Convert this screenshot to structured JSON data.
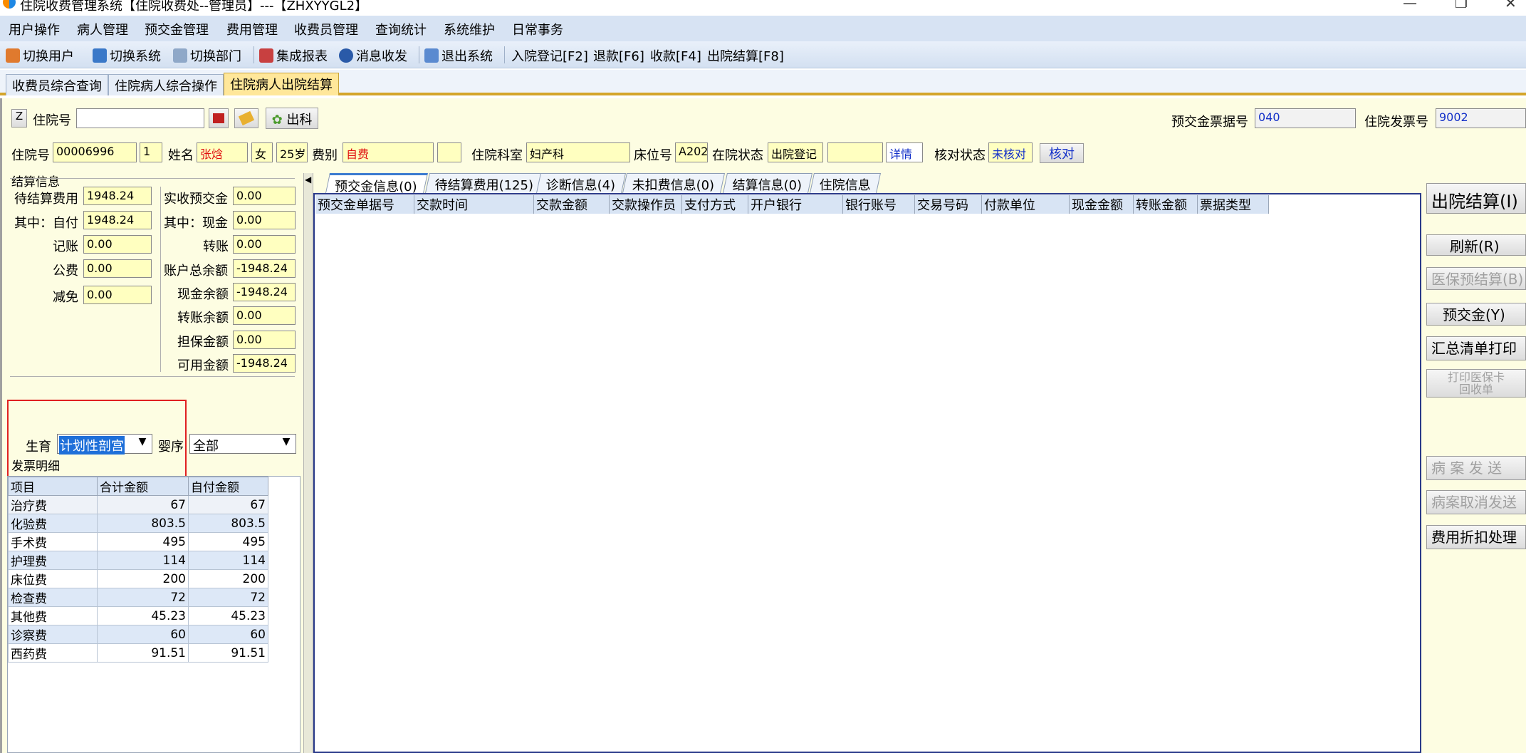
{
  "window": {
    "title": "住院收费管理系统【住院收费处--管理员】---【ZHXYYGL2】",
    "minimize": "—",
    "restore": "❐",
    "close": "✕"
  },
  "menu": [
    "用户操作",
    "病人管理",
    "预交金管理",
    "费用管理",
    "收费员管理",
    "查询统计",
    "系统维护",
    "日常事务"
  ],
  "toolbar": {
    "switch_user": "切换用户",
    "switch_system": "切换系统",
    "switch_dept": "切换部门",
    "report": "集成报表",
    "message": "消息收发",
    "exit": "退出系统",
    "admit": "入院登记[F2]",
    "refund": "退款[F6]",
    "charge": "收款[F4]",
    "discharge": "出院结算[F8]"
  },
  "tabs": [
    "收费员综合查询",
    "住院病人综合操作",
    "住院病人出院结算"
  ],
  "search": {
    "z_label": "Z",
    "inpatient_no_label": "住院号",
    "inpatient_no_value": "",
    "discharge_btn": "出科",
    "deposit_receipt_label": "预交金票据号",
    "deposit_receipt_value": "040",
    "invoice_label": "住院发票号",
    "invoice_value": "9002"
  },
  "patient": {
    "no_label": "住院号",
    "no_value": "00006996",
    "times": "1",
    "name_label": "姓名",
    "name_value": "张焓",
    "sex": "女",
    "age": "25岁",
    "fee_type_label": "费别",
    "fee_type_value": "自费",
    "fee_extra": "",
    "dept_label": "住院科室",
    "dept_value": "妇产科",
    "bed_label": "床位号",
    "bed_value": "A202",
    "status_label": "在院状态",
    "status_value": "出院登记",
    "status_extra": "",
    "detail_btn": "详情",
    "check_label": "核对状态",
    "check_value": "未核对",
    "check_btn": "核对"
  },
  "settle": {
    "group_title": "结算信息",
    "pending_label": "待结算费用",
    "pending_value": "1948.24",
    "self_label": "其中：自付",
    "self_value": "1948.24",
    "account_label": "记账",
    "account_value": "0.00",
    "public_label": "公费",
    "public_value": "0.00",
    "waive_label": "减免",
    "waive_value": "0.00",
    "actual_deposit_label": "实收预交金",
    "actual_deposit_value": "0.00",
    "cash_label": "其中：现金",
    "cash_value": "0.00",
    "transfer_label": "转账",
    "transfer_value": "0.00",
    "total_balance_label": "账户总余额",
    "total_balance_value": "-1948.24",
    "cash_balance_label": "现金余额",
    "cash_balance_value": "-1948.24",
    "transfer_balance_label": "转账余额",
    "transfer_balance_value": "0.00",
    "guarantee_label": "担保金额",
    "guarantee_value": "0.00",
    "available_label": "可用金额",
    "available_value": "-1948.24"
  },
  "birth": {
    "label": "生育",
    "value": "计划性剖宫",
    "order_label": "婴序",
    "order_value": "全部"
  },
  "invoice": {
    "group_title": "发票明细",
    "columns": [
      "项目",
      "合计金额",
      "自付金额"
    ],
    "rows": [
      [
        "治疗费",
        "67",
        "67"
      ],
      [
        "化验费",
        "803.5",
        "803.5"
      ],
      [
        "手术费",
        "495",
        "495"
      ],
      [
        "护理费",
        "114",
        "114"
      ],
      [
        "床位费",
        "200",
        "200"
      ],
      [
        "检查费",
        "72",
        "72"
      ],
      [
        "其他费",
        "45.23",
        "45.23"
      ],
      [
        "诊察费",
        "60",
        "60"
      ],
      [
        "西药费",
        "91.51",
        "91.51"
      ]
    ]
  },
  "right_tabs": [
    "预交金信息(0)",
    "待结算费用(125)",
    "诊断信息(4)",
    "未扣费信息(0)",
    "结算信息(0)",
    "住院信息"
  ],
  "deposit_columns": [
    "预交金单据号",
    "交款时间",
    "交款金额",
    "交款操作员",
    "支付方式",
    "开户银行",
    "银行账号",
    "交易号码",
    "付款单位",
    "现金金额",
    "转账金额",
    "票据类型"
  ],
  "side_buttons": {
    "discharge": "出院结算(I)",
    "refresh": "刷新(R)",
    "insurance_pre": "医保预结算(B)",
    "deposit": "预交金(Y)",
    "summary_print": "汇总清单打印",
    "print_card_line1": "打印医保卡",
    "print_card_line2": "回收单",
    "record_send": "病 案 发 送",
    "record_cancel": "病案取消发送",
    "discount": "费用折扣处理"
  }
}
